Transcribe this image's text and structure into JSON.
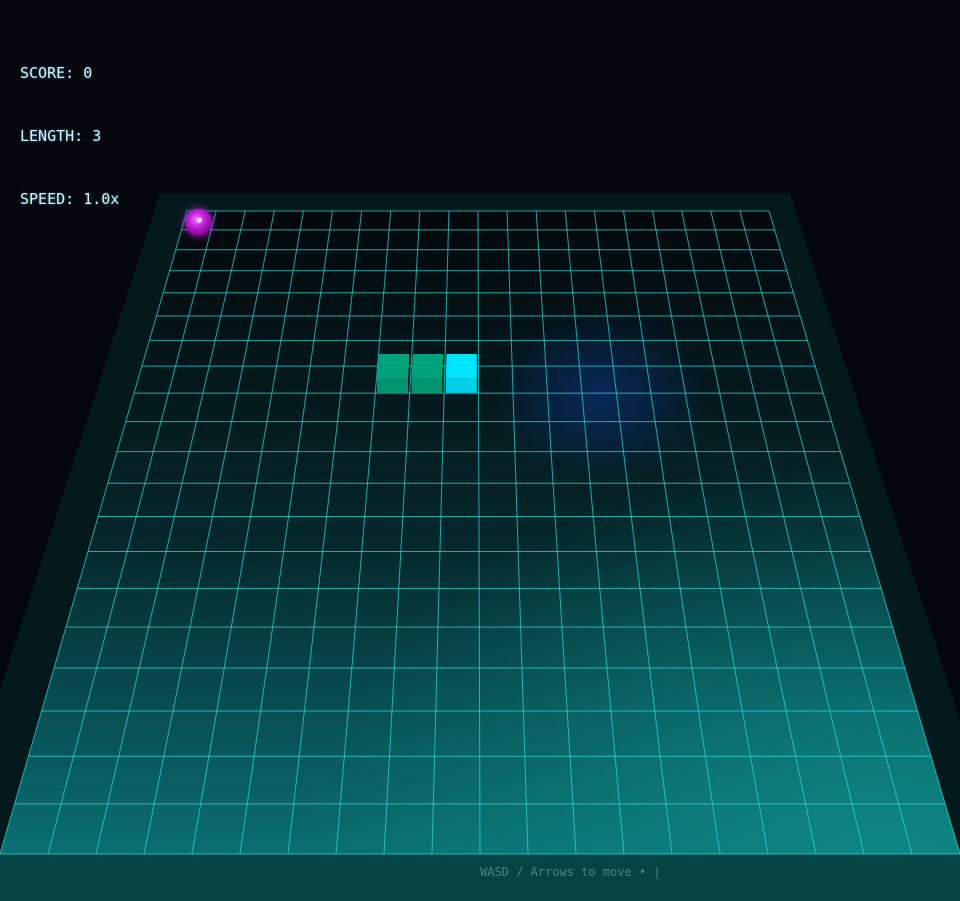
{
  "hud": {
    "score_label": "SCORE:",
    "score": "0",
    "length_label": "LENGTH:",
    "length": "3",
    "speed_label": "SPEED:",
    "speed": "1.0x"
  },
  "controls_hint": "WASD / Arrows to move • |",
  "board": {
    "columns": 20,
    "rows": 20,
    "grid_color": "#2fd6d0",
    "floor_color": "#0a6f72"
  },
  "snake": {
    "head_color": "#00e5ff",
    "body_color": "#00a37a",
    "segments": [
      {
        "col": 9,
        "row": 7,
        "part": "head"
      },
      {
        "col": 8,
        "row": 7,
        "part": "body"
      },
      {
        "col": 7,
        "row": 7,
        "part": "body"
      }
    ]
  },
  "food": {
    "col": 0,
    "row": 0,
    "color": "#c21cd6"
  }
}
